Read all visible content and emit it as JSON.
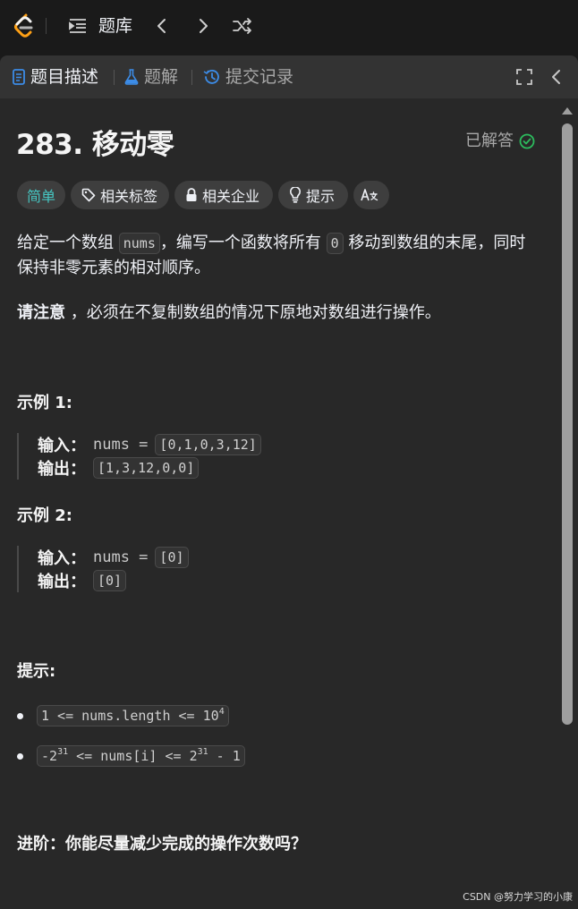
{
  "topbar": {
    "title": "题库"
  },
  "tabs": {
    "description": "题目描述",
    "solutions": "题解",
    "submissions": "提交记录"
  },
  "problem": {
    "title": "283. 移动零",
    "status": "已解答",
    "difficulty": "简单",
    "tags": [
      "相关标签",
      "相关企业",
      "提示"
    ],
    "translate_label": "A文",
    "desc_part1": "给定一个数组 ",
    "desc_code1": "nums",
    "desc_part2": "，编写一个函数将所有 ",
    "desc_code2": "0",
    "desc_part3": " 移动到数组的末尾，同时保持非零元素的相对顺序。",
    "note_bold": "请注意",
    "note_rest": " ，必须在不复制数组的情况下原地对数组进行操作。"
  },
  "examples": [
    {
      "heading": "示例 1:",
      "input_label": "输入：",
      "input_var": "nums =",
      "input_val": "[0,1,0,3,12]",
      "output_label": "输出：",
      "output_val": "[1,3,12,0,0]"
    },
    {
      "heading": "示例 2:",
      "input_label": "输入：",
      "input_var": "nums =",
      "input_val": "[0]",
      "output_label": "输出：",
      "output_val": "[0]"
    }
  ],
  "constraints": {
    "heading": "提示:",
    "c1_text": "1 <= nums.length <= 10",
    "c1_sup": "4",
    "c2_a": "-2",
    "c2_sup1": "31",
    "c2_b": " <= nums[i] <= 2",
    "c2_sup2": "31",
    "c2_c": " - 1"
  },
  "followup": "进阶：你能尽量减少完成的操作次数吗？",
  "watermark": "CSDN @努力学习的小康",
  "colors": {
    "easy": "#46c6c2",
    "solved_check": "#2cbb5d",
    "background": "#282828"
  }
}
